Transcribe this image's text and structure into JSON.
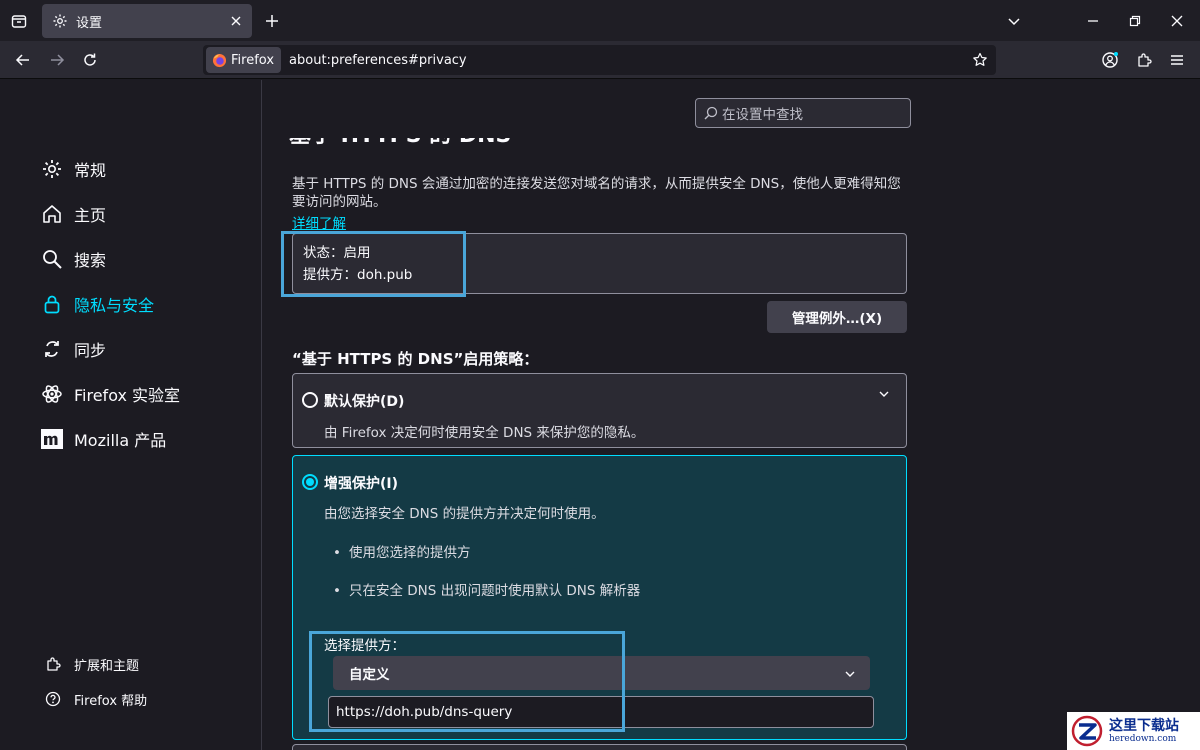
{
  "browser": {
    "tab_title": "设置",
    "identity_label": "Firefox",
    "url": "about:preferences#privacy"
  },
  "sidebar": {
    "categories": [
      {
        "label": "常规",
        "icon": "gear-icon"
      },
      {
        "label": "主页",
        "icon": "home-icon"
      },
      {
        "label": "搜索",
        "icon": "search-icon"
      },
      {
        "label": "隐私与安全",
        "icon": "lock-icon",
        "selected": true
      },
      {
        "label": "同步",
        "icon": "sync-icon"
      },
      {
        "label": "Firefox 实验室",
        "icon": "labs-icon"
      },
      {
        "label": "Mozilla 产品",
        "icon": "mozilla-icon"
      }
    ],
    "footer": {
      "extensions_label": "扩展和主题",
      "help_label": "Firefox 帮助"
    }
  },
  "main": {
    "search_placeholder": "在设置中查找",
    "section_title_clipped": "基于 HTTPS 的 DNS",
    "description": "基于 HTTPS 的 DNS 会通过加密的连接发送您对域名的请求，从而提供安全 DNS，使他人更难得知您要访问的网站。",
    "learn_more": "详细了解",
    "status_line": "状态：启用",
    "provider_line": "提供方：doh.pub",
    "manage_exceptions": "管理例外…(X)",
    "policy_title": "“基于 HTTPS 的 DNS”启用策略：",
    "option_default": {
      "label": "默认保护(D)",
      "desc": "由 Firefox 决定何时使用安全 DNS 来保护您的隐私。"
    },
    "option_increased": {
      "label": "增强保护(I)",
      "desc": "由您选择安全 DNS 的提供方并决定何时使用。",
      "bullets": [
        "使用您选择的提供方",
        "只在安全 DNS 出现问题时使用默认 DNS 解析器"
      ],
      "provider_label": "选择提供方：",
      "provider_value": "自定义",
      "custom_url": "https://doh.pub/dns-query"
    }
  },
  "colors": {
    "accent": "#00ddff",
    "highlight_box": "#4aa6d9",
    "background": "#1c1b22"
  },
  "watermark": {
    "cn": "这里下载站",
    "en": "heredown.com"
  }
}
